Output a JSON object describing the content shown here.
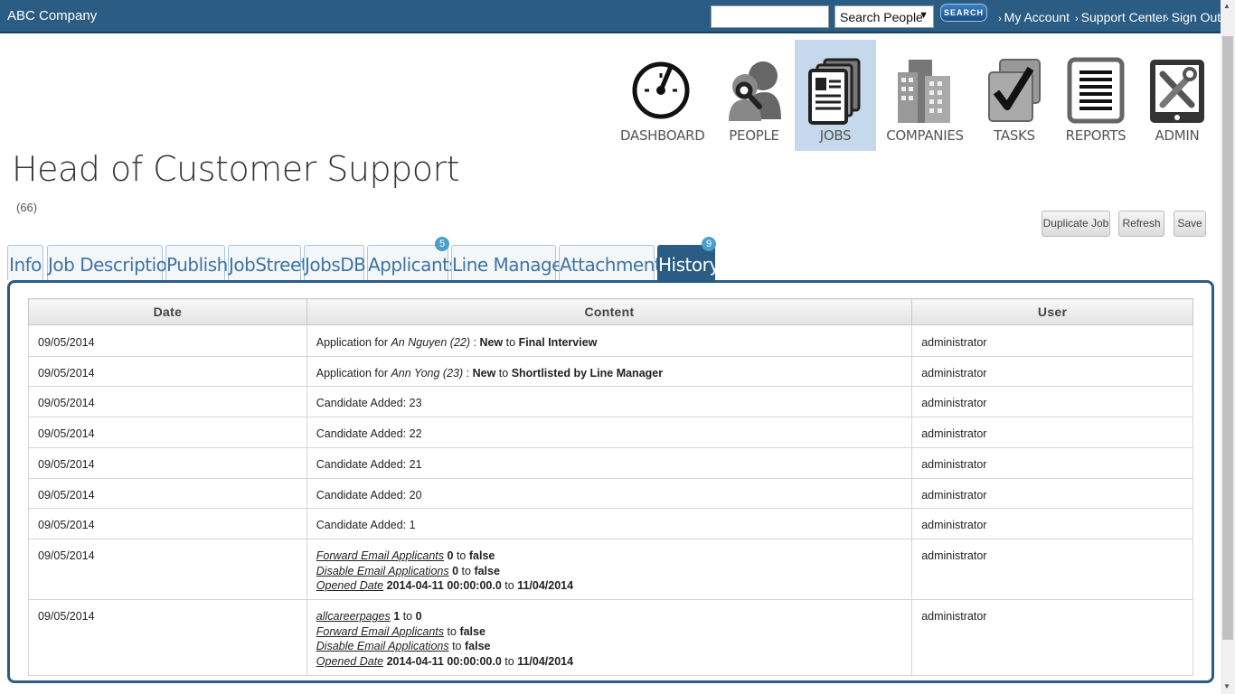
{
  "header": {
    "brand": "ABC Company",
    "search_value": "",
    "search_scope": "Search People",
    "search_button": "SEARCH",
    "links": [
      "My Account",
      "Support Center",
      "Sign Out"
    ]
  },
  "nav": [
    {
      "label": "DASHBOARD",
      "icon": "dashboard-gauge-icon",
      "active": false
    },
    {
      "label": "PEOPLE",
      "icon": "people-icon",
      "active": false
    },
    {
      "label": "JOBS",
      "icon": "jobs-documents-icon",
      "active": true
    },
    {
      "label": "COMPANIES",
      "icon": "companies-buildings-icon",
      "active": false
    },
    {
      "label": "TASKS",
      "icon": "tasks-checkbox-icon",
      "active": false
    },
    {
      "label": "REPORTS",
      "icon": "reports-list-icon",
      "active": false
    },
    {
      "label": "ADMIN",
      "icon": "admin-tools-icon",
      "active": false
    }
  ],
  "page": {
    "title": "Head of Customer Support",
    "count": "(66)"
  },
  "actions": [
    "Duplicate Job",
    "Refresh",
    "Save"
  ],
  "tabs": [
    {
      "label": "Info"
    },
    {
      "label": "Job Description"
    },
    {
      "label": "Publish"
    },
    {
      "label": "JobStreet"
    },
    {
      "label": "JobsDB"
    },
    {
      "label": "Applicants",
      "badge": "5"
    },
    {
      "label": "Line Manager"
    },
    {
      "label": "Attachments"
    },
    {
      "label": "History",
      "badge": "9",
      "active": true
    }
  ],
  "table": {
    "headers": [
      "Date",
      "Content",
      "User"
    ],
    "rows": [
      {
        "date": "09/05/2014",
        "user": "administrator",
        "content": {
          "type": "application",
          "prefix": "Application for",
          "candidate": "An Nguyen (22)",
          "from": "New",
          "to_word": "to",
          "to": "Final Interview"
        }
      },
      {
        "date": "09/05/2014",
        "user": "administrator",
        "content": {
          "type": "application",
          "prefix": "Application for",
          "candidate": "Ann Yong (23)",
          "from": "New",
          "to_word": "to",
          "to": "Shortlisted by Line Manager"
        }
      },
      {
        "date": "09/05/2014",
        "user": "administrator",
        "content": {
          "type": "text",
          "text": "Candidate Added: 23"
        }
      },
      {
        "date": "09/05/2014",
        "user": "administrator",
        "content": {
          "type": "text",
          "text": "Candidate Added: 22"
        }
      },
      {
        "date": "09/05/2014",
        "user": "administrator",
        "content": {
          "type": "text",
          "text": "Candidate Added: 21"
        }
      },
      {
        "date": "09/05/2014",
        "user": "administrator",
        "content": {
          "type": "text",
          "text": "Candidate Added: 20"
        }
      },
      {
        "date": "09/05/2014",
        "user": "administrator",
        "content": {
          "type": "text",
          "text": "Candidate Added: 1"
        }
      },
      {
        "date": "09/05/2014",
        "user": "administrator",
        "content": {
          "type": "changes",
          "changes": [
            {
              "field": "Forward Email Applicants",
              "from": "0",
              "to_word": "to",
              "to": "false"
            },
            {
              "field": "Disable Email Applications",
              "from": "0",
              "to_word": "to",
              "to": "false"
            },
            {
              "field": "Opened Date",
              "from": "2014-04-11 00:00:00.0",
              "to_word": "to",
              "to": "11/04/2014"
            }
          ]
        }
      },
      {
        "date": "09/05/2014",
        "user": "administrator",
        "content": {
          "type": "changes",
          "changes": [
            {
              "field": "allcareerpages",
              "from": "1",
              "to_word": "to",
              "to": "0"
            },
            {
              "field": "Forward Email Applicants",
              "from": "",
              "to_word": "to",
              "to": "false"
            },
            {
              "field": "Disable Email Applications",
              "from": "",
              "to_word": "to",
              "to": "false"
            },
            {
              "field": "Opened Date",
              "from": "2014-04-11 00:00:00.0",
              "to_word": "to",
              "to": "11/04/2014"
            }
          ]
        }
      }
    ]
  },
  "colors": {
    "header_bg": "#2a5c84",
    "tab_text": "#3f73a5",
    "active_nav_bg": "#c6d9ec",
    "badge": "#4aa0c8"
  }
}
